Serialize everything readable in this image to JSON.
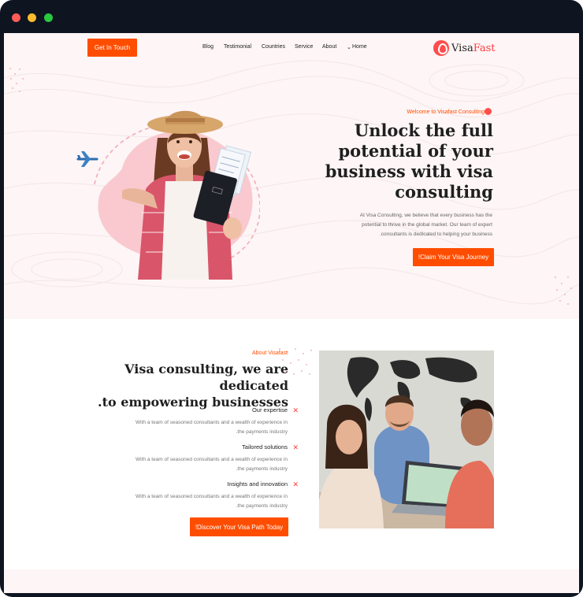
{
  "window": {
    "controls": [
      "close",
      "minimize",
      "maximize"
    ]
  },
  "header": {
    "cta_label": "Get In Touch",
    "nav": [
      "Blog",
      "Testimonial",
      "Countries",
      "Service",
      "About",
      "Home"
    ],
    "logo": {
      "part1": "Visa",
      "part2": "Fast"
    }
  },
  "hero": {
    "welcome": "Welcome to Visafast Consulting",
    "title": "Unlock the full potential of your business with visa consulting",
    "text_lines": [
      "At Visa Consulting, we believe that every business has the",
      "potential to thrive in the global market. Our team of expert",
      ".consultants is dedicated to helping your business"
    ],
    "cta_label": "!Claim Your Visa Journey"
  },
  "about": {
    "label": "About Visafast",
    "title_lines": [
      "Visa consulting, we are dedicated",
      ".to empowering businesses"
    ],
    "features": [
      {
        "title": "Our expertise",
        "desc_lines": [
          "With a team of seasoned consultants and a wealth of experience in",
          ".the payments industry"
        ]
      },
      {
        "title": "Tailored solutions",
        "desc_lines": [
          "With a team of seasoned consultants and a wealth of experience in",
          ".the payments industry"
        ]
      },
      {
        "title": "Insights and innovation",
        "desc_lines": [
          "With a team of seasoned consultants and a wealth of experience in",
          ".the payments industry"
        ]
      }
    ],
    "cta_label": "!Discover Your Visa Path Today"
  },
  "colors": {
    "accent": "#ff4d00",
    "brand_red": "#ff3b3b",
    "hero_bg": "#fdf5f6",
    "blob": "#f9c9cf"
  },
  "icons": {
    "feature_marker": "x-mark-icon",
    "logo": "location-pin-icon",
    "plane": "airplane-icon",
    "chevron": "chevron-down-icon"
  }
}
